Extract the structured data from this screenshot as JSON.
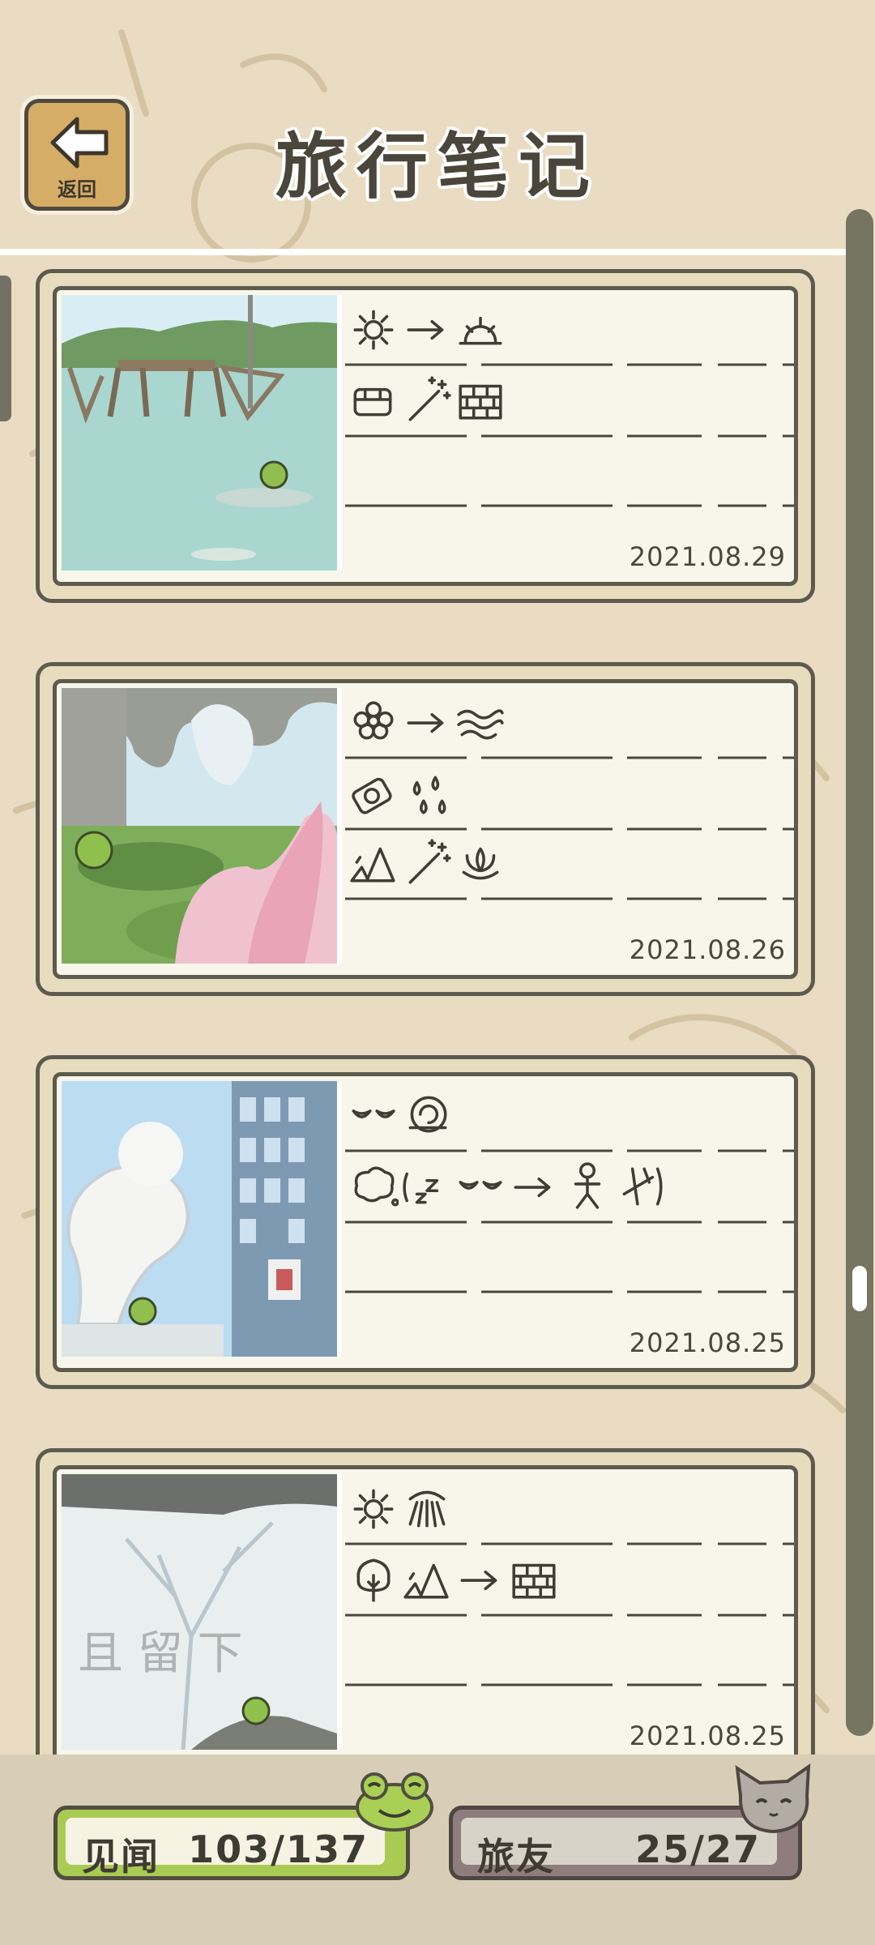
{
  "header": {
    "back_label": "返回",
    "title": "旅行笔记"
  },
  "entries": [
    {
      "date": "2021.08.29",
      "scene": "lake-patio",
      "lines": [
        [
          "sun-icon",
          "arrow-icon",
          "sunset-icon"
        ],
        [
          "lunchbox-icon",
          "magic-wand-icon",
          "brick-wall-icon"
        ],
        []
      ]
    },
    {
      "date": "2021.08.26",
      "scene": "lotus-garden",
      "lines": [
        [
          "flower-icon",
          "arrow-icon",
          "wind-icon"
        ],
        [
          "camera-icon",
          "water-drops-icon"
        ],
        [
          "mountains-icon",
          "magic-wand-icon",
          "lotus-icon"
        ]
      ]
    },
    {
      "date": "2021.08.25",
      "scene": "city-sculpture",
      "lines": [
        [
          "closed-eyes-icon",
          "snail-icon"
        ],
        [
          "thought-bubble-icon",
          "sleep-icon",
          "closed-eyes-icon",
          "arrow-icon",
          "person-icon",
          "person-jump-icon"
        ],
        []
      ]
    },
    {
      "date": "2021.08.25",
      "scene": "ink-wall",
      "lines": [
        [
          "sun-icon",
          "sun-rays-icon"
        ],
        [
          "tree-icon",
          "mountains-icon",
          "arrow-icon",
          "brick-wall-icon"
        ],
        []
      ]
    }
  ],
  "footer": {
    "seen_label": "见闻",
    "seen_count": "103/137",
    "friends_label": "旅友",
    "friends_count": "25/27"
  },
  "colors": {
    "background": "#eadcc2",
    "card_border": "#5d5b4e",
    "paper": "#f8f6ea",
    "seen_green": "#aacb53",
    "friend_mauve": "#8f7c7c"
  }
}
